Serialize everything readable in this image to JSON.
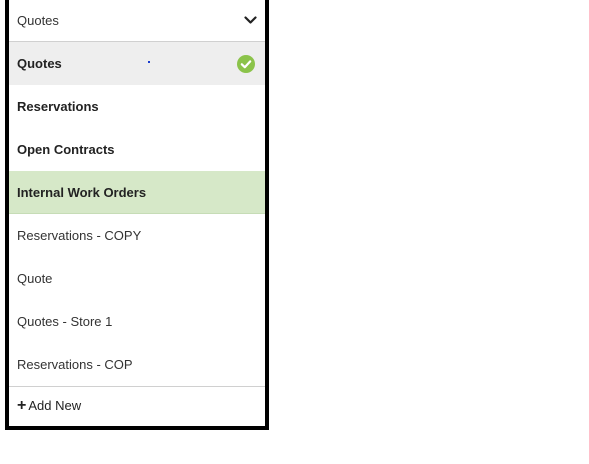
{
  "select": {
    "value": "Quotes",
    "icon": "chevron-down-icon"
  },
  "items": [
    {
      "label": "Quotes",
      "bold": true,
      "selected": true,
      "check": "check-circle-icon"
    },
    {
      "label": "Reservations",
      "bold": true
    },
    {
      "label": "Open Contracts",
      "bold": true
    },
    {
      "label": "Internal Work Orders",
      "bold": true,
      "highlighted": true
    },
    {
      "label": "Reservations - COPY",
      "bold": false
    },
    {
      "label": "Quote",
      "bold": false
    },
    {
      "label": "Quotes - Store 1",
      "bold": false
    },
    {
      "label": "Reservations - COP",
      "bold": false
    }
  ],
  "footer": {
    "plus": "+",
    "label": "Add New"
  },
  "colors": {
    "check": "#8bc34a",
    "highlight": "#d6e8c8",
    "selected": "#eeeeee",
    "frame": "#000000"
  }
}
